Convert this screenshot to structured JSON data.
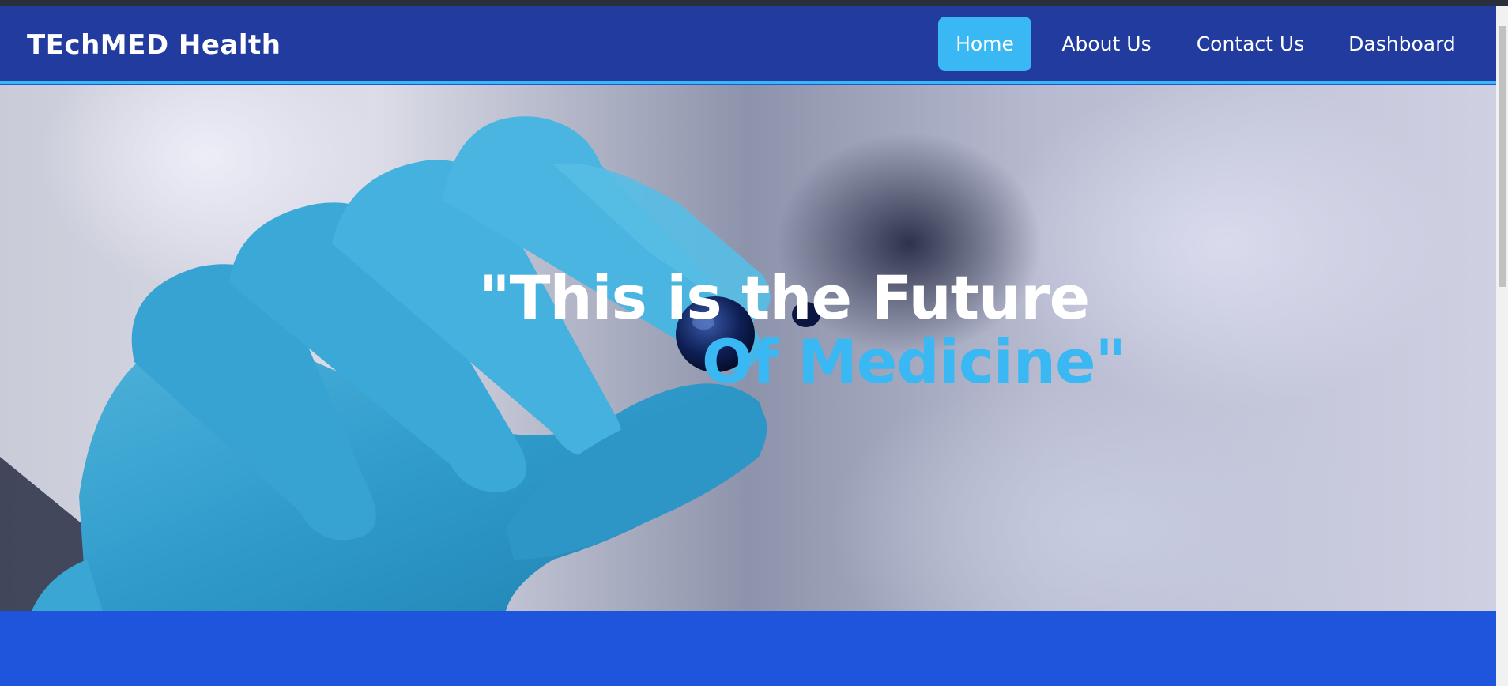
{
  "navbar": {
    "brand": "TEchMED Health",
    "items": [
      {
        "label": "Home",
        "active": true
      },
      {
        "label": "About Us",
        "active": false
      },
      {
        "label": "Contact Us",
        "active": false
      },
      {
        "label": "Dashboard",
        "active": false
      }
    ]
  },
  "hero": {
    "headline_line1": "\"This is the Future",
    "headline_line2": "Of Medicine\"",
    "image": "gloved-hand-holding-capsule"
  },
  "colors": {
    "navbar_bg": "#213b9e",
    "accent": "#39b8f3",
    "section_bg": "#1f55dc",
    "text": "#ffffff"
  }
}
